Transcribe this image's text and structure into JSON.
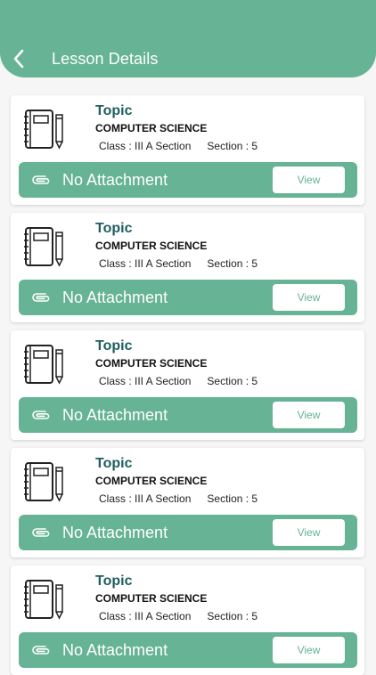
{
  "header": {
    "title": "Lesson Details",
    "back_icon": "chevron-left-icon"
  },
  "colors": {
    "accent": "#66b395",
    "topic": "#1f5d62"
  },
  "lessons": [
    {
      "topic": "Topic",
      "subject": "COMPUTER SCIENCE",
      "class": "Class : III A Section",
      "section": "Section : 5",
      "attachment": "No Attachment",
      "view_label": "View"
    },
    {
      "topic": "Topic",
      "subject": "COMPUTER SCIENCE",
      "class": "Class : III A Section",
      "section": "Section : 5",
      "attachment": "No Attachment",
      "view_label": "View"
    },
    {
      "topic": "Topic",
      "subject": "COMPUTER SCIENCE",
      "class": "Class : III A Section",
      "section": "Section : 5",
      "attachment": "No Attachment",
      "view_label": "View"
    },
    {
      "topic": "Topic",
      "subject": "COMPUTER SCIENCE",
      "class": "Class : III A Section",
      "section": "Section : 5",
      "attachment": "No Attachment",
      "view_label": "View"
    },
    {
      "topic": "Topic",
      "subject": "COMPUTER SCIENCE",
      "class": "Class : III A Section",
      "section": "Section : 5",
      "attachment": "No Attachment",
      "view_label": "View"
    }
  ]
}
